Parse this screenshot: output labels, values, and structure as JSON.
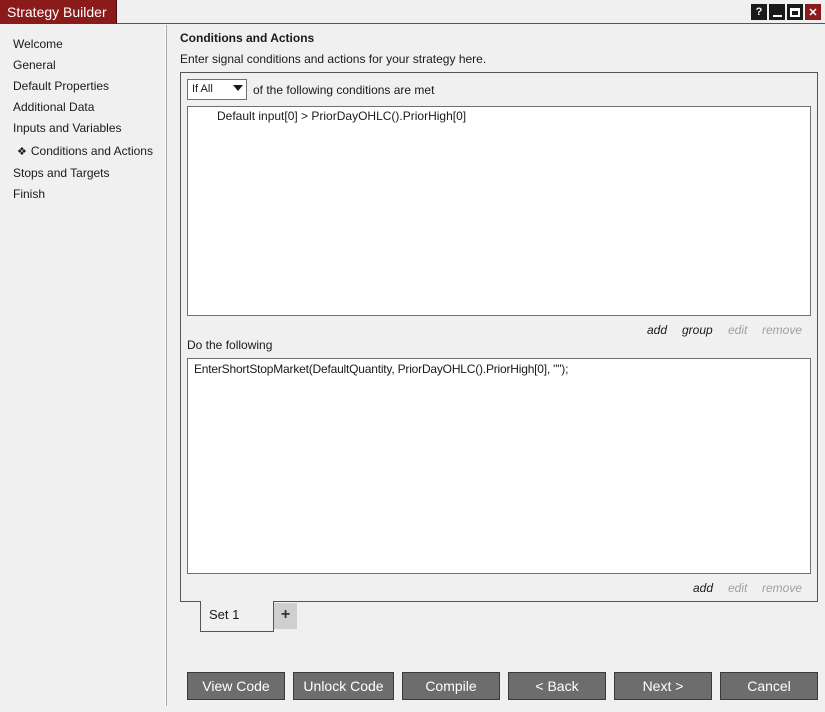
{
  "window": {
    "title": "Strategy Builder",
    "help_label": "?",
    "close_label": "✕"
  },
  "sidebar": {
    "items": [
      {
        "label": "Welcome"
      },
      {
        "label": "General"
      },
      {
        "label": "Default Properties"
      },
      {
        "label": "Additional Data"
      },
      {
        "label": "Inputs and Variables"
      },
      {
        "label": "Conditions and Actions",
        "active": true,
        "marker": "❖"
      },
      {
        "label": "Stops and Targets"
      },
      {
        "label": "Finish"
      }
    ]
  },
  "main": {
    "title": "Conditions and Actions",
    "description": "Enter signal conditions and actions for your strategy here.",
    "condition_mode": {
      "selected": "If All",
      "suffix": "of the following conditions are met"
    },
    "conditions": [
      "Default input[0] > PriorDayOHLC().PriorHigh[0]"
    ],
    "condition_links": {
      "add": "add",
      "group": "group",
      "edit": "edit",
      "remove": "remove"
    },
    "actions_label": "Do the following",
    "actions": [
      "EnterShortStopMarket(DefaultQuantity, PriorDayOHLC().PriorHigh[0], \"\");"
    ],
    "action_links": {
      "add": "add",
      "edit": "edit",
      "remove": "remove"
    },
    "sets": [
      {
        "label": "Set 1"
      }
    ],
    "add_set_label": "+"
  },
  "footer": {
    "buttons": {
      "view_code": "View Code",
      "unlock_code": "Unlock Code",
      "compile": "Compile",
      "back": "< Back",
      "next": "Next >",
      "cancel": "Cancel"
    }
  },
  "colors": {
    "title_accent": "#8b1a1a",
    "button_bg": "#6d6d6d",
    "disabled_link": "#a0a0a0"
  }
}
